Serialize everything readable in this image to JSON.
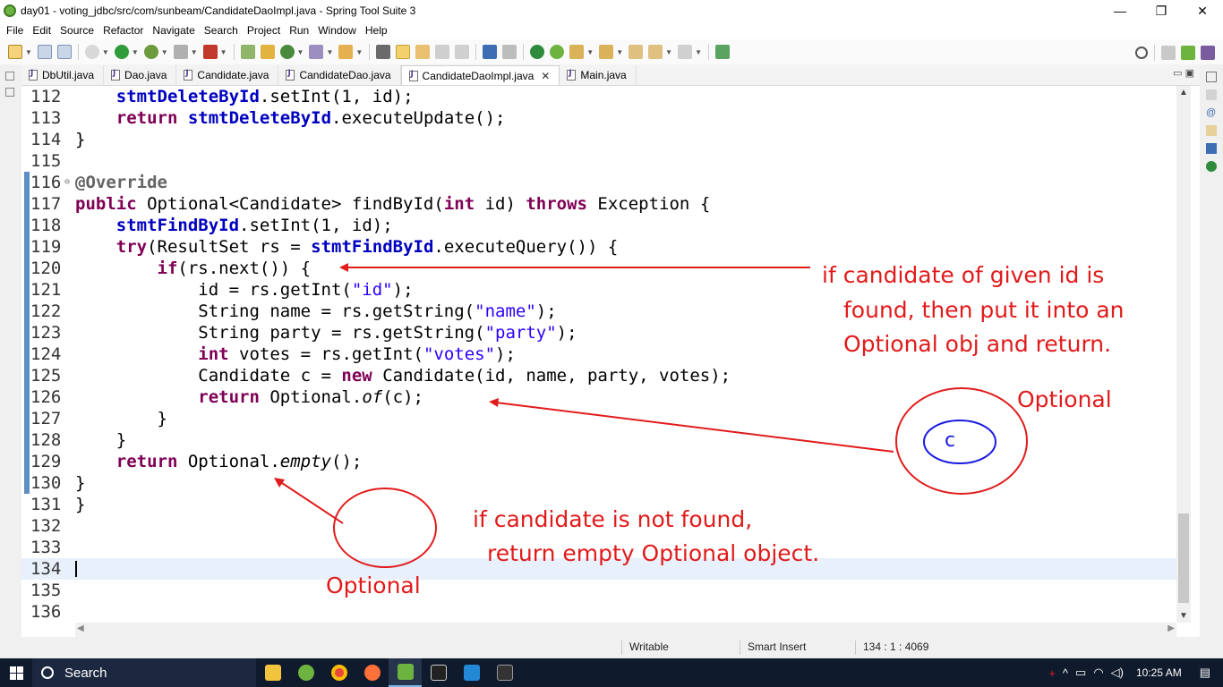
{
  "window": {
    "title": "day01 - voting_jdbc/src/com/sunbeam/CandidateDaoImpl.java - Spring Tool Suite 3",
    "controls": {
      "minimize": "—",
      "restore": "❐",
      "close": "✕"
    }
  },
  "menu": [
    "File",
    "Edit",
    "Source",
    "Refactor",
    "Navigate",
    "Search",
    "Project",
    "Run",
    "Window",
    "Help"
  ],
  "tabs": [
    {
      "label": "DbUtil.java",
      "active": false
    },
    {
      "label": "Dao.java",
      "active": false
    },
    {
      "label": "Candidate.java",
      "active": false
    },
    {
      "label": "CandidateDao.java",
      "active": false
    },
    {
      "label": "CandidateDaoImpl.java",
      "active": true
    },
    {
      "label": "Main.java",
      "active": false
    }
  ],
  "tab_close": "✕",
  "editor": {
    "line_numbers": [
      "112",
      "113",
      "114",
      "115",
      "116",
      "117",
      "118",
      "119",
      "120",
      "121",
      "122",
      "123",
      "124",
      "125",
      "126",
      "127",
      "128",
      "129",
      "130",
      "131",
      "132",
      "133",
      "134",
      "135",
      "136"
    ],
    "current_line": "134"
  },
  "status": {
    "mode": "Writable",
    "insert": "Smart Insert",
    "position": "134 : 1 : 4069"
  },
  "annotations": {
    "note1_line1": "if candidate of given id is",
    "note1_line2": "found, then put it into an",
    "note1_line3": "Optional obj and return.",
    "optional_label_1": "Optional",
    "c_label": "c",
    "note2_line1": "if candidate is not found,",
    "note2_line2": "return empty Optional object.",
    "optional_label_2": "Optional",
    "colors": {
      "annotation": "#e11b1b",
      "inner_circle": "#1a1ae0"
    }
  },
  "taskbar": {
    "search_label": "Search",
    "time": "10:25 AM",
    "apps": [
      "file-explorer",
      "spring-tool-suite",
      "chrome",
      "firefox",
      "spring-tool-suite-2",
      "terminal",
      "vscode",
      "cmd"
    ]
  }
}
